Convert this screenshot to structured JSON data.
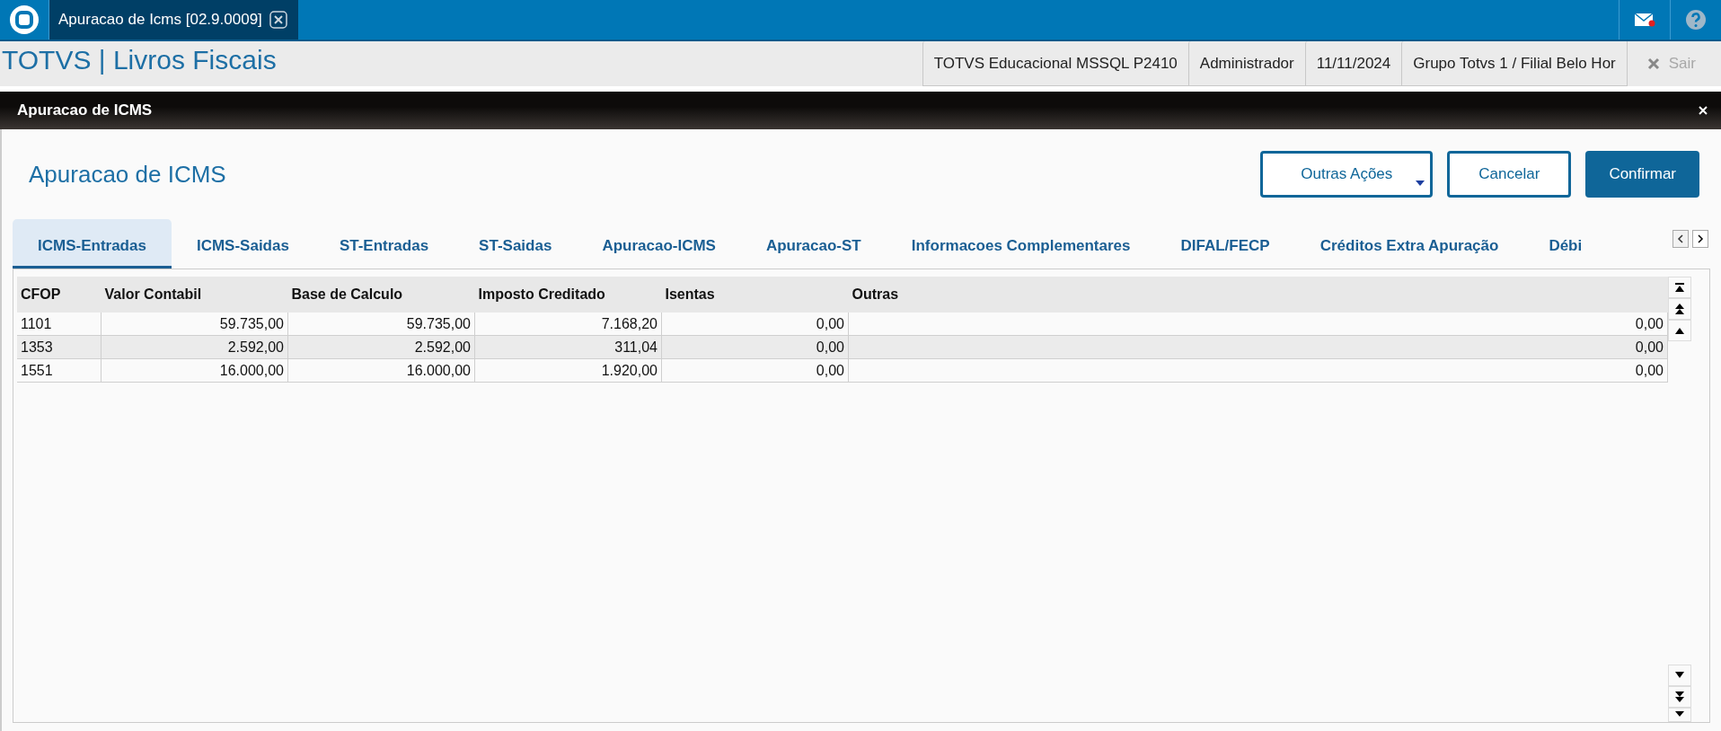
{
  "app_tab": {
    "label": "Apuracao de Icms [02.9.0009]"
  },
  "header": {
    "title": "TOTVS | Livros Fiscais",
    "info": [
      "TOTVS Educacional MSSQL P2410",
      "Administrador",
      "11/11/2024",
      "Grupo Totvs 1 / Filial Belo Hor"
    ],
    "exit": {
      "label": "Sair",
      "disabled": true
    }
  },
  "dialog": {
    "title": "Apuracao de ICMS",
    "heading": "Apuracao de ICMS",
    "buttons": [
      {
        "label": "Outras Ações",
        "kind": "menu"
      },
      {
        "label": "Cancelar",
        "kind": "outline"
      },
      {
        "label": "Confirmar",
        "kind": "primary"
      }
    ],
    "tabs": [
      {
        "label": "ICMS-Entradas",
        "selected": true
      },
      {
        "label": "ICMS-Saidas",
        "selected": false
      },
      {
        "label": "ST-Entradas",
        "selected": false
      },
      {
        "label": "ST-Saidas",
        "selected": false
      },
      {
        "label": "Apuracao-ICMS",
        "selected": false
      },
      {
        "label": "Apuracao-ST",
        "selected": false
      },
      {
        "label": "Informacoes Complementares",
        "selected": false
      },
      {
        "label": "DIFAL/FECP",
        "selected": false
      },
      {
        "label": "Créditos Extra Apuração",
        "selected": false
      },
      {
        "label": "Débi",
        "selected": false
      }
    ],
    "table": {
      "columns": [
        "CFOP",
        "Valor Contabil",
        "Base de Calculo",
        "Imposto Creditado",
        "Isentas",
        "Outras"
      ],
      "rows": [
        [
          "1101",
          "59.735,00",
          "59.735,00",
          "7.168,20",
          "0,00",
          "0,00"
        ],
        [
          "1353",
          "2.592,00",
          "2.592,00",
          "311,04",
          "0,00",
          "0,00"
        ],
        [
          "1551",
          "16.000,00",
          "16.000,00",
          "1.920,00",
          "0,00",
          "0,00"
        ]
      ]
    }
  }
}
